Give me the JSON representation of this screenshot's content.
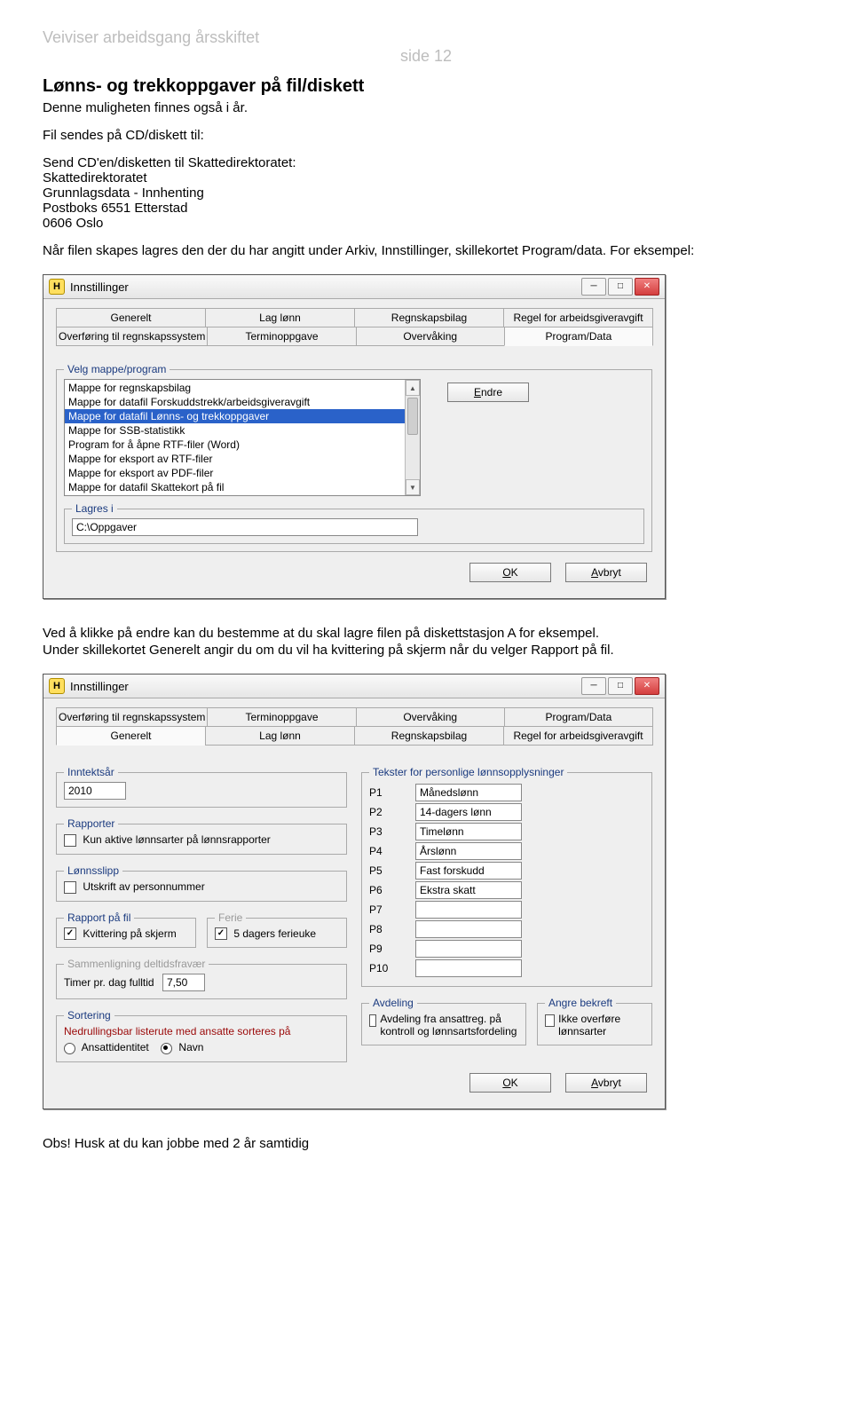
{
  "header": {
    "title": "Veiviser arbeidsgang årsskiftet",
    "page": "side 12"
  },
  "intro": {
    "h": "Lønns- og trekkoppgaver på fil/diskett",
    "p1": "Denne muligheten finnes også i år.",
    "p2": "Fil sendes på CD/diskett til:",
    "addr": {
      "l1": "Send CD'en/disketten til Skattedirektoratet:",
      "l2": "Skattedirektoratet",
      "l3": "Grunnlagsdata - Innhenting",
      "l4": "Postboks 6551 Etterstad",
      "l5": "0606 Oslo"
    },
    "p3": "Når filen skapes lagres den der du har angitt under Arkiv, Innstillinger, skillekortet Program/data. For eksempel:"
  },
  "win1": {
    "title": "Innstillinger",
    "tabs1": [
      "Generelt",
      "Lag lønn",
      "Regnskapsbilag",
      "Regel for arbeidsgiveravgift"
    ],
    "tabs2": [
      "Overføring til regnskapssystem",
      "Terminoppgave",
      "Overvåking",
      "Program/Data"
    ],
    "group1": "Velg mappe/program",
    "listItems": [
      "Mappe for regnskapsbilag",
      "Mappe for datafil Forskuddstrekk/arbeidsgiveravgift",
      "Mappe for datafil Lønns- og trekkoppgaver",
      "Mappe for SSB-statistikk",
      "Program for å åpne RTF-filer (Word)",
      "Mappe for eksport av RTF-filer",
      "Mappe for eksport av PDF-filer",
      "Mappe for datafil Skattekort på fil"
    ],
    "selectedIndex": 2,
    "endreBtn": "Endre",
    "group2": "Lagres i",
    "path": "C:\\Oppgaver",
    "ok": "OK",
    "cancel": "Avbryt"
  },
  "middle": {
    "p1": "Ved å klikke på endre kan du bestemme at du skal lagre filen på diskettstasjon A for eksempel.",
    "p2": "Under skillekortet Generelt angir du om du vil ha kvittering på skjerm når du velger Rapport på fil."
  },
  "win2": {
    "title": "Innstillinger",
    "tabs1": [
      "Overføring til regnskapssystem",
      "Terminoppgave",
      "Overvåking",
      "Program/Data"
    ],
    "tabs2": [
      "Generelt",
      "Lag lønn",
      "Regnskapsbilag",
      "Regel for arbeidsgiveravgift"
    ],
    "groups": {
      "inntekt": {
        "label": "Inntektsår",
        "value": "2010"
      },
      "rapporter": {
        "label": "Rapporter",
        "chk": "Kun aktive lønnsarter på lønnsrapporter"
      },
      "lonnslipp": {
        "label": "Lønnsslipp",
        "chk": "Utskrift av personnummer"
      },
      "rapportfil": {
        "label": "Rapport på fil",
        "chk": "Kvittering på skjerm"
      },
      "ferie": {
        "label": "Ferie",
        "chk": "5 dagers ferieuke"
      },
      "sammen": {
        "label": "Sammenligning deltidsfravær",
        "txt": "Timer pr. dag fulltid",
        "val": "7,50"
      },
      "sortering": {
        "label": "Sortering",
        "txt": "Nedrullingsbar listerute med ansatte sorteres på",
        "r1": "Ansattidentitet",
        "r2": "Navn"
      },
      "tekster": {
        "label": "Tekster for personlige lønnsopplysninger"
      },
      "pRows": [
        {
          "p": "P1",
          "v": "Månedslønn"
        },
        {
          "p": "P2",
          "v": "14-dagers lønn"
        },
        {
          "p": "P3",
          "v": "Timelønn"
        },
        {
          "p": "P4",
          "v": "Årslønn"
        },
        {
          "p": "P5",
          "v": "Fast forskudd"
        },
        {
          "p": "P6",
          "v": "Ekstra skatt"
        },
        {
          "p": "P7",
          "v": ""
        },
        {
          "p": "P8",
          "v": ""
        },
        {
          "p": "P9",
          "v": ""
        },
        {
          "p": "P10",
          "v": ""
        }
      ],
      "avdeling": {
        "label": "Avdeling",
        "chk": "Avdeling fra ansattreg. på kontroll og lønnsartsfordeling"
      },
      "angre": {
        "label": "Angre bekreft",
        "chk": "Ikke overføre lønnsarter"
      }
    },
    "ok": "OK",
    "cancel": "Avbryt"
  },
  "footnote": "Obs! Husk at du kan jobbe med 2 år samtidig",
  "ui": {
    "okU": "O",
    "okRest": "K",
    "cancelU": "A",
    "cancelRest": "vbryt",
    "endreU": "E",
    "endreRest": "ndre"
  }
}
